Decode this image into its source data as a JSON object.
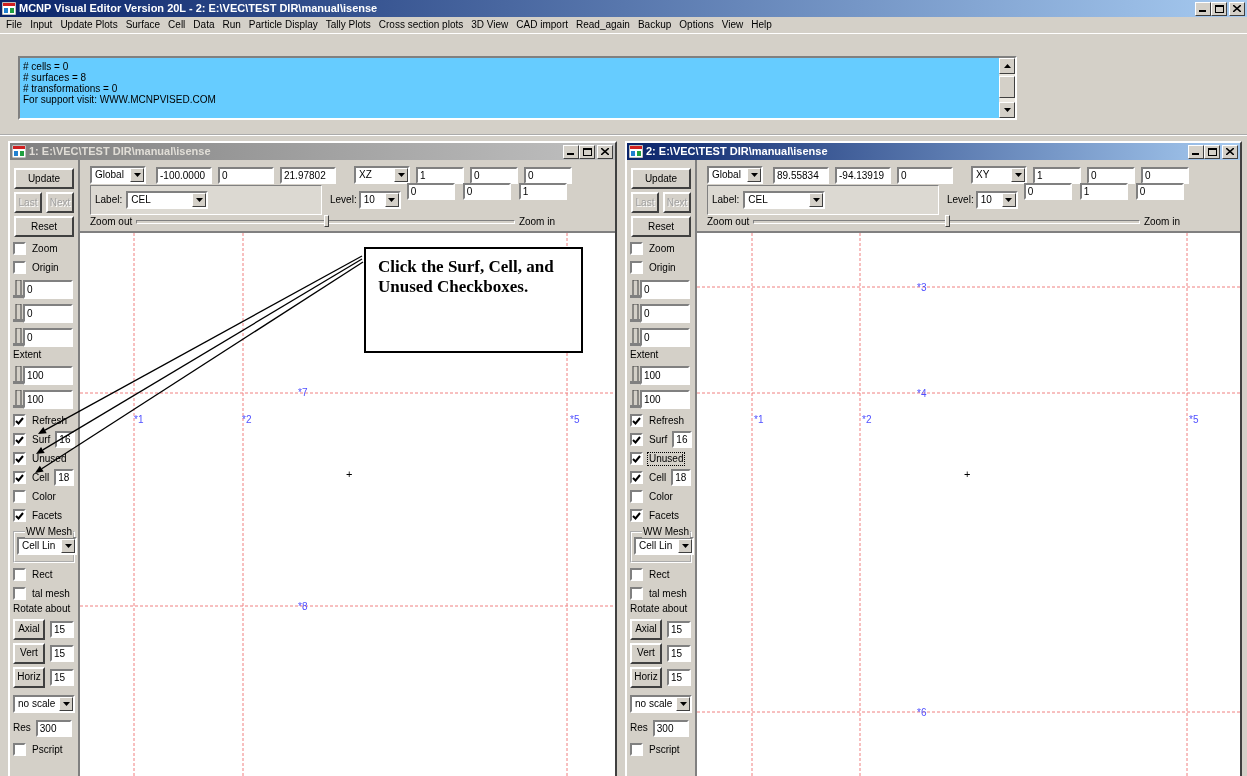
{
  "window": {
    "title": "MCNP Visual Editor Version 20L - 2:  E:\\VEC\\TEST DIR\\manual\\isense"
  },
  "menu": [
    "File",
    "Input",
    "Update Plots",
    "Surface",
    "Cell",
    "Data",
    "Run",
    "Particle Display",
    "Tally Plots",
    "Cross section plots",
    "3D View",
    "CAD import",
    "Read_again",
    "Backup",
    "Options",
    "View",
    "Help"
  ],
  "info": {
    "lines": [
      "# cells = 0",
      "# surfaces = 8",
      "# transformations = 0",
      "For support visit: WWW.MCNPVISED.COM"
    ]
  },
  "plot_windows": [
    {
      "title": "1: E:\\VEC\\TEST DIR\\manual\\isense",
      "active": false,
      "toolbar": {
        "basis": "Global",
        "point": [
          "-100.0000",
          "0",
          "21.97802"
        ],
        "plane": "XZ",
        "axis_1": [
          "1",
          "0",
          "0"
        ],
        "axis_2": [
          "0",
          "0",
          "1"
        ],
        "label_caption": "Label:",
        "label_mode": "CEL",
        "level_caption": "Level:",
        "level_value": "10",
        "zoom_out": "Zoom out",
        "zoom_in": "Zoom in",
        "zoom_slider": {
          "level": 0.5
        }
      },
      "sidebar": [
        {
          "kind": "button",
          "label": "Update",
          "disabled": false
        },
        {
          "kind": "button_pair",
          "buttons": [
            {
              "label": "Last",
              "disabled": true
            },
            {
              "label": "Next",
              "disabled": true
            }
          ]
        },
        {
          "kind": "button",
          "label": "Reset",
          "disabled": false
        },
        {
          "kind": "checkbox",
          "label": "Zoom",
          "checked": false,
          "focused": false
        },
        {
          "kind": "checkbox",
          "label": "Origin",
          "checked": false,
          "focused": false
        },
        {
          "kind": "slider_field",
          "value": "0"
        },
        {
          "kind": "slider_field",
          "value": "0"
        },
        {
          "kind": "slider_field",
          "value": "0"
        },
        {
          "kind": "caption",
          "label": "Extent"
        },
        {
          "kind": "slider_field",
          "value": "100"
        },
        {
          "kind": "slider_field",
          "value": "100"
        },
        {
          "kind": "checkbox",
          "label": "Refresh",
          "checked": true,
          "focused": false
        },
        {
          "kind": "checkbox_field",
          "label": "Surf",
          "checked": true,
          "focused": false,
          "value": "16"
        },
        {
          "kind": "checkbox",
          "label": "Unused",
          "checked": true,
          "focused": false
        },
        {
          "kind": "checkbox_field",
          "label": "Cell",
          "checked": true,
          "focused": false,
          "value": "18"
        },
        {
          "kind": "checkbox",
          "label": "Color",
          "checked": false,
          "focused": false
        },
        {
          "kind": "checkbox",
          "label": "Facets",
          "checked": true,
          "focused": false
        },
        {
          "kind": "group",
          "title": "WW Mesh",
          "dropdown": "Cell Lin"
        },
        {
          "kind": "checkbox",
          "label": "Rect",
          "checked": false,
          "focused": false
        },
        {
          "kind": "checkbox",
          "label": "tal mesh",
          "checked": false,
          "focused": false
        },
        {
          "kind": "caption",
          "label": "Rotate about"
        },
        {
          "kind": "button_field",
          "label": "Axial",
          "value": "15"
        },
        {
          "kind": "button_field",
          "label": "Vert",
          "value": "15"
        },
        {
          "kind": "button_field",
          "label": "Horiz",
          "value": "15"
        },
        {
          "kind": "dropdown",
          "value": "no scale"
        },
        {
          "kind": "labeled_field",
          "label": "Res",
          "value": "300"
        },
        {
          "kind": "checkbox",
          "label": "Pscript",
          "checked": false,
          "focused": false
        }
      ],
      "plot": {
        "surface_labels": [
          "*7",
          "*1",
          "*2",
          "*5",
          "*8"
        ],
        "origin_mark": "+"
      }
    },
    {
      "title": "2: E:\\VEC\\TEST DIR\\manual\\isense",
      "active": true,
      "toolbar": {
        "basis": "Global",
        "point": [
          "89.55834",
          "-94.13919",
          "0"
        ],
        "plane": "XY",
        "axis_1": [
          "1",
          "0",
          "0"
        ],
        "axis_2": [
          "0",
          "1",
          "0"
        ],
        "label_caption": "Label:",
        "label_mode": "CEL",
        "level_caption": "Level:",
        "level_value": "10",
        "zoom_out": "Zoom out",
        "zoom_in": "Zoom in",
        "zoom_slider": {
          "level": 0.5
        }
      },
      "sidebar": [
        {
          "kind": "button",
          "label": "Update",
          "disabled": false
        },
        {
          "kind": "button_pair",
          "buttons": [
            {
              "label": "Last",
              "disabled": true
            },
            {
              "label": "Next",
              "disabled": true
            }
          ]
        },
        {
          "kind": "button",
          "label": "Reset",
          "disabled": false
        },
        {
          "kind": "checkbox",
          "label": "Zoom",
          "checked": false,
          "focused": false
        },
        {
          "kind": "checkbox",
          "label": "Origin",
          "checked": false,
          "focused": false
        },
        {
          "kind": "slider_field",
          "value": "0"
        },
        {
          "kind": "slider_field",
          "value": "0"
        },
        {
          "kind": "slider_field",
          "value": "0"
        },
        {
          "kind": "caption",
          "label": "Extent"
        },
        {
          "kind": "slider_field",
          "value": "100"
        },
        {
          "kind": "slider_field",
          "value": "100"
        },
        {
          "kind": "checkbox",
          "label": "Refresh",
          "checked": true,
          "focused": false
        },
        {
          "kind": "checkbox_field",
          "label": "Surf",
          "checked": true,
          "focused": false,
          "value": "16"
        },
        {
          "kind": "checkbox",
          "label": "Unused",
          "checked": true,
          "focused": true
        },
        {
          "kind": "checkbox_field",
          "label": "Cell",
          "checked": true,
          "focused": false,
          "value": "18"
        },
        {
          "kind": "checkbox",
          "label": "Color",
          "checked": false,
          "focused": false
        },
        {
          "kind": "checkbox",
          "label": "Facets",
          "checked": true,
          "focused": false
        },
        {
          "kind": "group",
          "title": "WW Mesh",
          "dropdown": "Cell Lin"
        },
        {
          "kind": "checkbox",
          "label": "Rect",
          "checked": false,
          "focused": false
        },
        {
          "kind": "checkbox",
          "label": "tal mesh",
          "checked": false,
          "focused": false
        },
        {
          "kind": "caption",
          "label": "Rotate about"
        },
        {
          "kind": "button_field",
          "label": "Axial",
          "value": "15"
        },
        {
          "kind": "button_field",
          "label": "Vert",
          "value": "15"
        },
        {
          "kind": "button_field",
          "label": "Horiz",
          "value": "15"
        },
        {
          "kind": "dropdown",
          "value": "no scale"
        },
        {
          "kind": "labeled_field",
          "label": "Res",
          "value": "300"
        },
        {
          "kind": "checkbox",
          "label": "Pscript",
          "checked": false,
          "focused": false
        }
      ],
      "plot": {
        "surface_labels": [
          "*3",
          "*4",
          "*1",
          "*2",
          "*5",
          "*6"
        ],
        "origin_mark": "+"
      }
    }
  ],
  "callout": {
    "text": "Click the Surf, Cell, and Unused Checkboxes."
  }
}
